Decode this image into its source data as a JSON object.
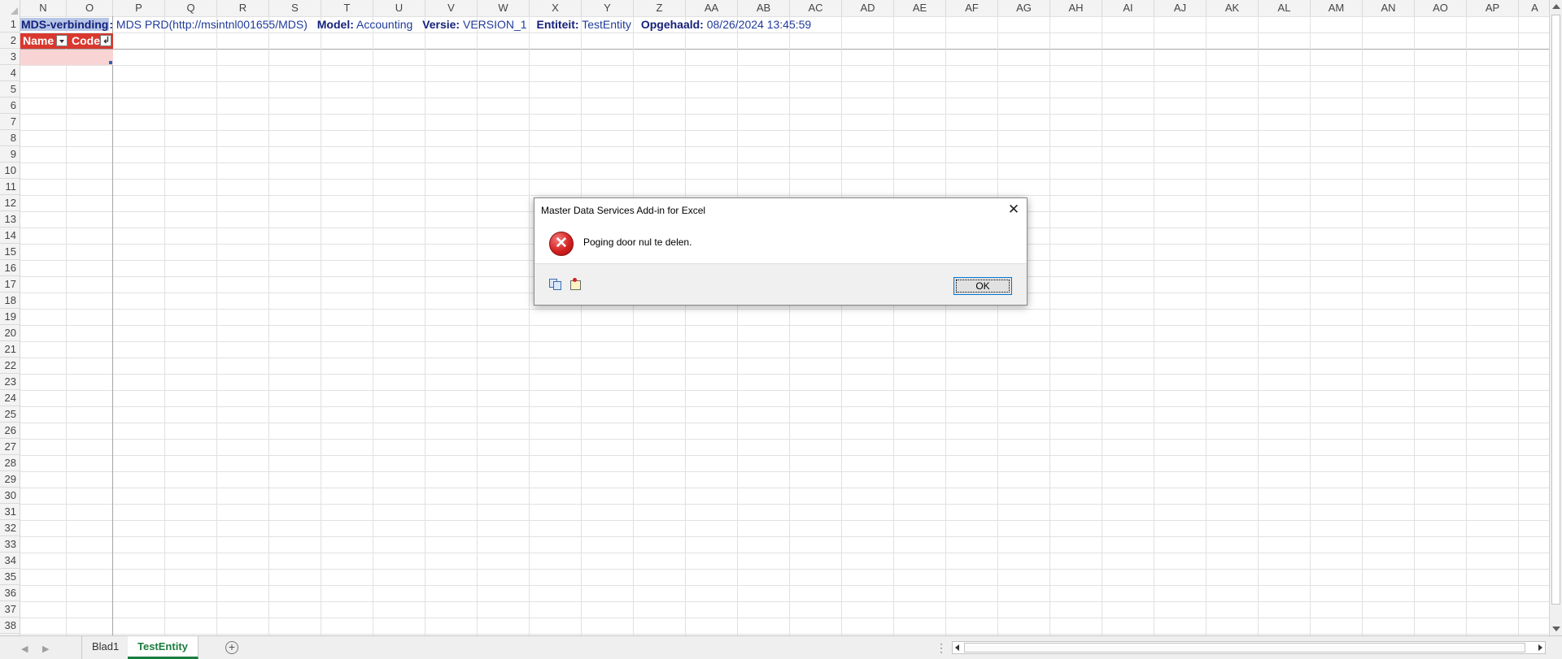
{
  "columns": [
    "N",
    "O",
    "P",
    "Q",
    "R",
    "S",
    "T",
    "U",
    "V",
    "W",
    "X",
    "Y",
    "Z",
    "AA",
    "AB",
    "AC",
    "AD",
    "AE",
    "AF",
    "AG",
    "AH",
    "AI",
    "AJ",
    "AK",
    "AL",
    "AM",
    "AN",
    "AO",
    "AP",
    "A"
  ],
  "rows": [
    "1",
    "2",
    "3",
    "4",
    "5",
    "6",
    "7",
    "8",
    "9",
    "10",
    "11",
    "12",
    "13",
    "14",
    "15",
    "16",
    "17",
    "18",
    "19",
    "20",
    "21",
    "22",
    "23",
    "24",
    "25",
    "26",
    "27",
    "28",
    "29",
    "30",
    "31",
    "32",
    "33",
    "34",
    "35",
    "36",
    "37",
    "38"
  ],
  "connection": {
    "conn_label": "MDS-verbinding",
    "conn_value": "MDS PRD(http://msintnl001655/MDS)",
    "model_label": "Model:",
    "model_value": "Accounting",
    "version_label": "Versie:",
    "version_value": "VERSION_1",
    "entity_label": "Entiteit:",
    "entity_value": "TestEntity",
    "fetched_label": "Opgehaald:",
    "fetched_value": "08/26/2024 13:45:59"
  },
  "table_headers": {
    "name": "Name",
    "code": "Code"
  },
  "dialog": {
    "title": "Master Data Services Add-in for Excel",
    "message": "Poging door nul te delen.",
    "ok_label": "OK",
    "close_glyph": "✕"
  },
  "tabs": {
    "sheet1": "Blad1",
    "sheet2": "TestEntity",
    "add_glyph": "+",
    "dots": "⋮"
  },
  "colors": {
    "header_red": "#d9382f",
    "active_tab_green": "#1b7c3e",
    "conn_blue": "#1f3b9a"
  }
}
